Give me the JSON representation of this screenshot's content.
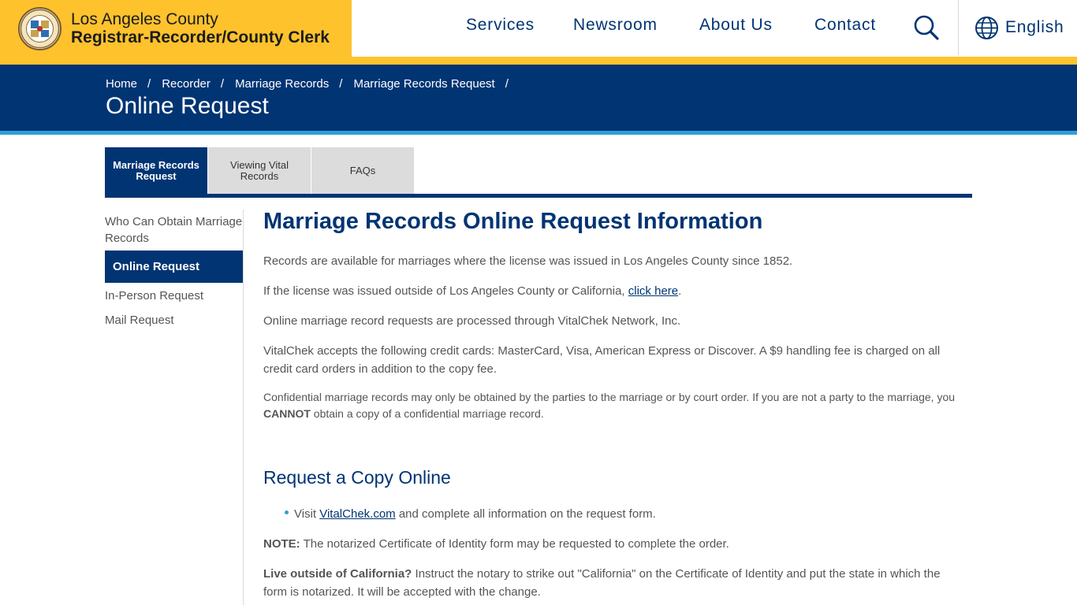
{
  "header": {
    "county_line": "Los Angeles County",
    "department_line": "Registrar-Recorder/County Clerk",
    "nav": [
      "Services",
      "Newsroom",
      "About Us",
      "Contact"
    ],
    "language_label": "English",
    "brand_color": "#fec22d",
    "primary_color": "#003473"
  },
  "banner": {
    "breadcrumb": [
      "Home",
      "Recorder",
      "Marriage Records",
      "Marriage Records Request"
    ],
    "title": "Online Request"
  },
  "tabs": [
    "Marriage Records Request",
    "Viewing Vital Records",
    "FAQs"
  ],
  "sidenav": {
    "items": [
      "Who Can Obtain Marriage Records",
      "Online Request",
      "In-Person Request",
      "Mail Request"
    ],
    "active_index": 1
  },
  "main": {
    "heading": "Marriage Records Online Request Information",
    "p1": "Records are available for marriages where the license was issued in Los Angeles County since 1852.",
    "p2_before": "If the license was issued outside of Los Angeles County or California, ",
    "p2_link": "click here",
    "p2_after": ".",
    "p3": "Online marriage record requests are processed through VitalChek Network, Inc.",
    "p4": "VitalChek accepts the following credit cards: MasterCard, Visa, American Express or Discover. A $9 handling fee is charged on all credit card orders in addition to the copy fee.",
    "p5_before": "Confidential marriage records may only be obtained by the parties to the marriage or by court order. If you are not a party to the marriage, you ",
    "p5_bold": "CANNOT",
    "p5_after": " obtain a copy of a confidential marriage record.",
    "subheading": "Request a Copy Online",
    "bullet_before": "Visit ",
    "bullet_link": "VitalChek.com",
    "bullet_after": " and complete all information on the request form.",
    "note_label": "NOTE:",
    "note_text": " The notarized Certificate of Identity form may be requested to complete the order.",
    "live_label": "Live outside of California?",
    "live_text": " Instruct the notary to strike out \"California\" on the Certificate of Identity and put the state in which the form is notarized. It will be accepted with the change."
  }
}
